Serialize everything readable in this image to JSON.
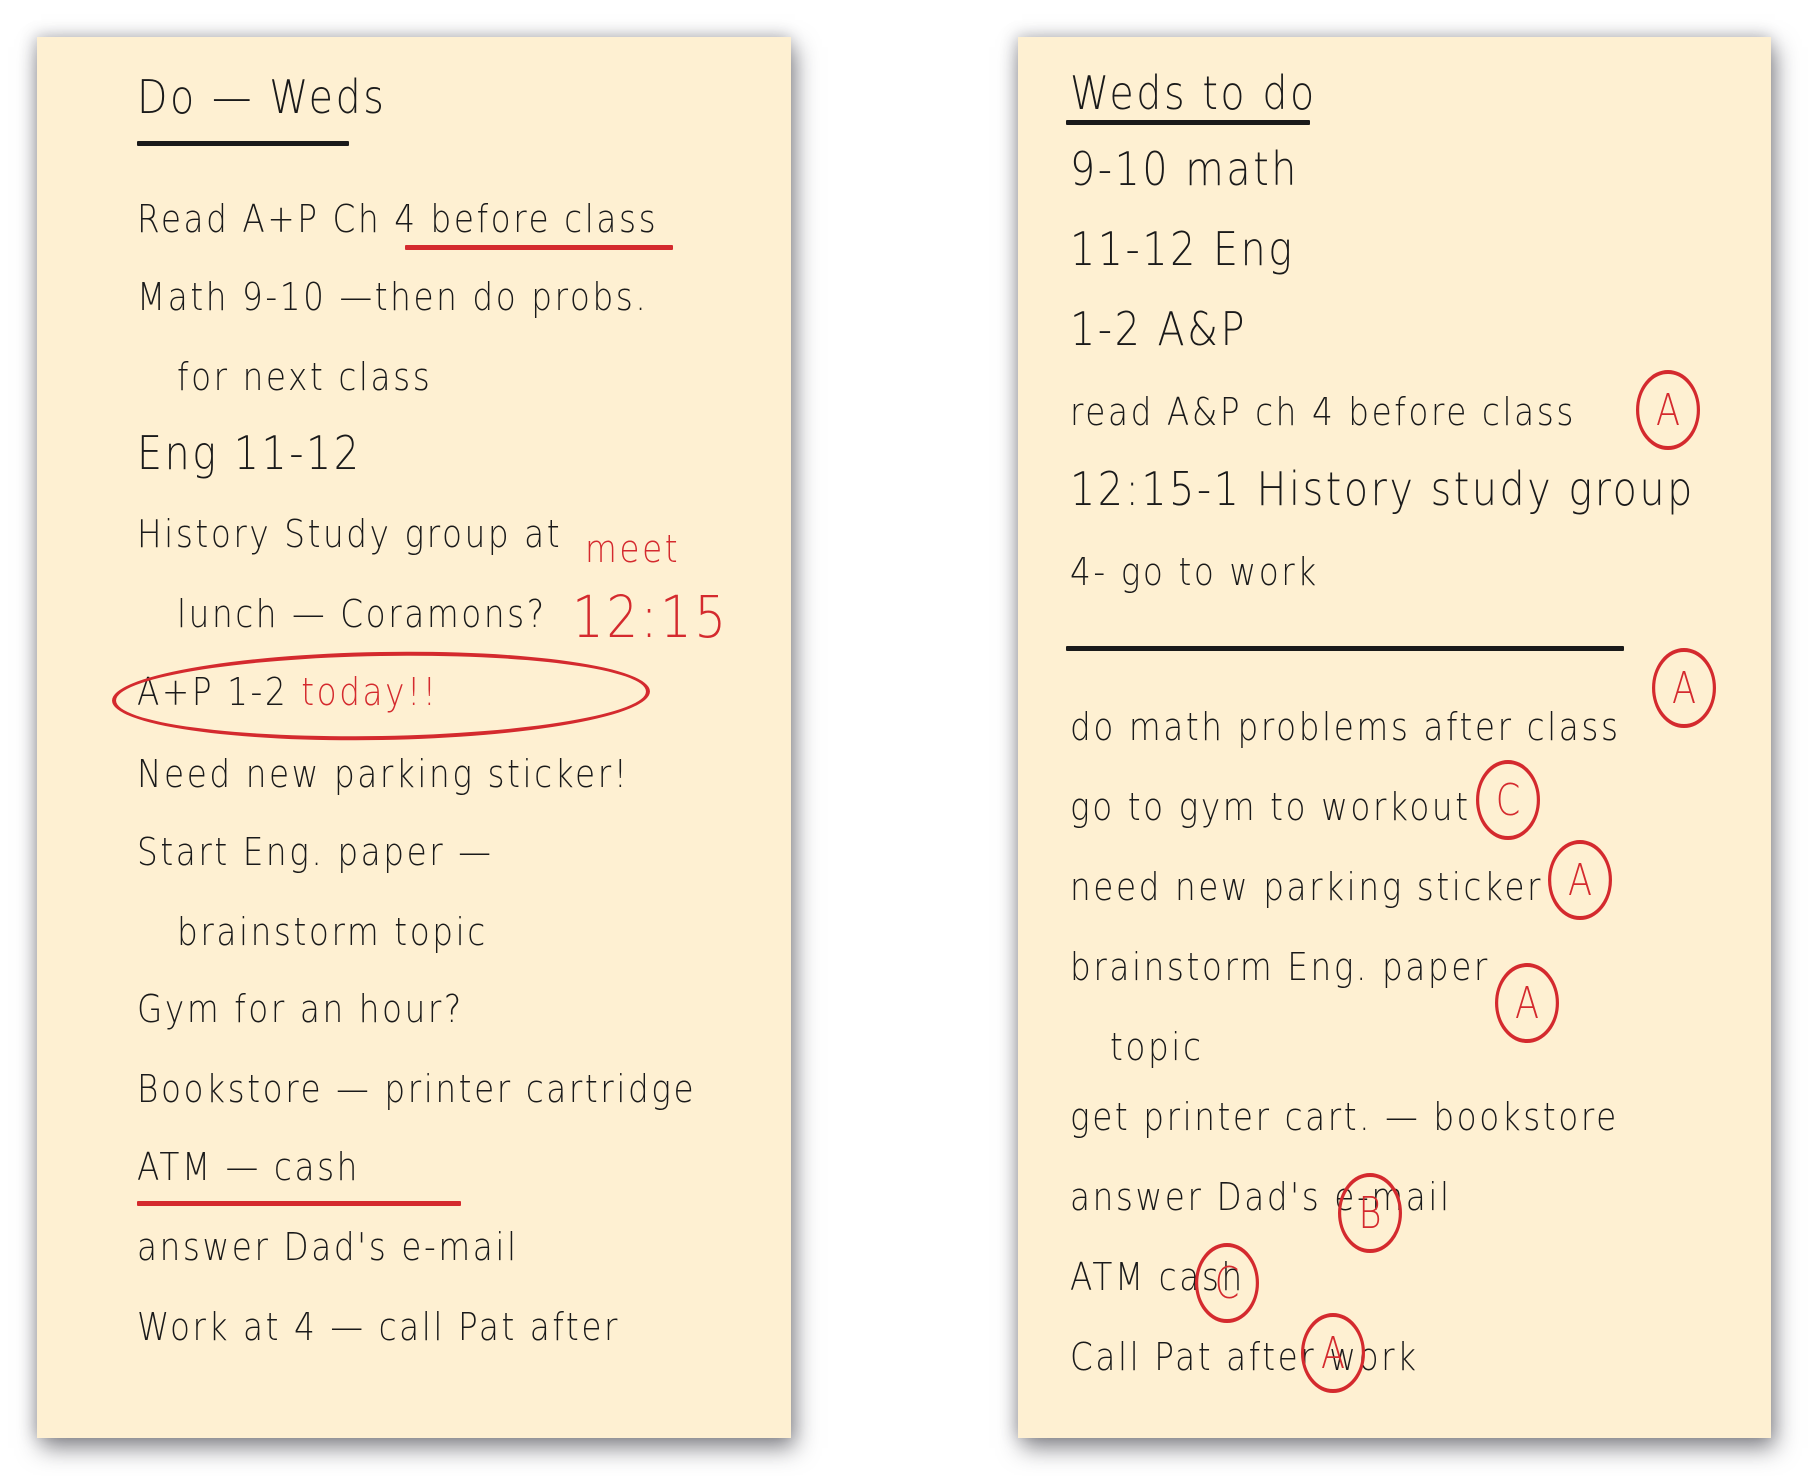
{
  "colors": {
    "paper": "#FEF0D2",
    "ink": "#1a1a1a",
    "red_ink": "#D42A2E",
    "background": "#ffffff"
  },
  "left_note": {
    "title": "Do — Weds",
    "lines": [
      {
        "text": "Read A+P Ch 4 before class"
      },
      {
        "text": "Math 9-10 —then do probs."
      },
      {
        "text": "for next class"
      },
      {
        "text": "Eng 11-12"
      },
      {
        "text": "History Study group at"
      },
      {
        "text": "lunch  — Coramons?"
      },
      {
        "text": "A+P 1-2"
      },
      {
        "text": "Need new parking sticker!"
      },
      {
        "text": "Start Eng. paper —"
      },
      {
        "text": "brainstorm topic"
      },
      {
        "text": "Gym for an hour?"
      },
      {
        "text": "Bookstore  — printer cartridge"
      },
      {
        "text": "ATM — cash"
      },
      {
        "text": "answer Dad's e-mail"
      },
      {
        "text": "Work at 4 — call Pat after"
      }
    ],
    "annotations": {
      "meet": "meet",
      "time": "12:15",
      "today": "today!!"
    }
  },
  "right_note": {
    "title": "Weds to do",
    "scheduled": [
      {
        "text": "9-10 math",
        "grade": ""
      },
      {
        "text": "11-12 Eng",
        "grade": ""
      },
      {
        "text": "1-2 A&P",
        "grade": ""
      },
      {
        "text": "read A&P ch 4 before class",
        "grade": "A"
      },
      {
        "text": "12:15-1 History study group",
        "grade": ""
      },
      {
        "text": "4- go to work",
        "grade": ""
      }
    ],
    "tasks": [
      {
        "text": "do math problems after class",
        "grade": "A"
      },
      {
        "text": "go to gym to workout",
        "grade": "C"
      },
      {
        "text": "need new parking sticker",
        "grade": "A"
      },
      {
        "text": "brainstorm Eng. paper",
        "grade": "A"
      },
      {
        "text": "topic",
        "grade": ""
      },
      {
        "text": "get printer cart. — bookstore",
        "grade": ""
      },
      {
        "text": "answer Dad's e-mail",
        "grade": "B"
      },
      {
        "text": "ATM cash",
        "grade": "C"
      },
      {
        "text": "Call Pat after work",
        "grade": "A"
      }
    ]
  }
}
